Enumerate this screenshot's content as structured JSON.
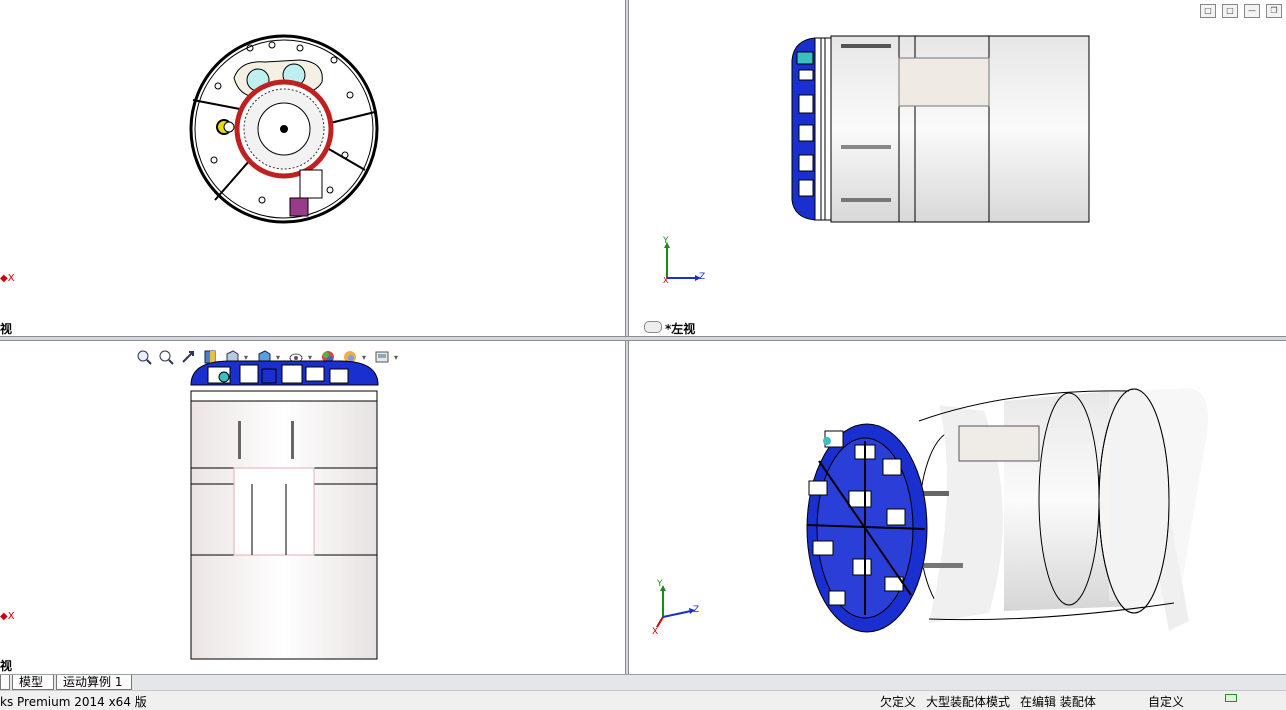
{
  "viewports": {
    "top_left": {
      "view_label": "视",
      "axis_label": "X"
    },
    "top_right": {
      "view_label": "*左视",
      "triad": {
        "y": "Y",
        "z": "Z",
        "x": "X"
      }
    },
    "bottom_left": {
      "view_label": "视",
      "axis_label": "X"
    },
    "bottom_right": {
      "triad": {
        "y": "Y",
        "z": "Z",
        "x": "X"
      }
    }
  },
  "heads_up_toolbar": {
    "icons": [
      "zoom-to-fit-icon",
      "zoom-to-area-icon",
      "previous-view-icon",
      "section-view-icon",
      "view-orientation-icon",
      "display-style-icon",
      "hide-show-items-icon",
      "edit-appearance-icon",
      "apply-scene-icon",
      "view-settings-icon"
    ]
  },
  "tabs": [
    {
      "label": "模型"
    },
    {
      "label": "运动算例 1"
    }
  ],
  "status_bar": {
    "app_name": "ks Premium 2014 x64 版",
    "definition_state": "欠定义",
    "assembly_mode": "大型装配体模式",
    "editing": "在编辑 装配体",
    "units": "自定义"
  },
  "colors": {
    "splitter": "#d4d6da",
    "part_blue": "#1a2fd0",
    "axis_red": "#c00000",
    "axis_green": "#1a8a1a",
    "axis_blue": "#1a2fd0"
  }
}
